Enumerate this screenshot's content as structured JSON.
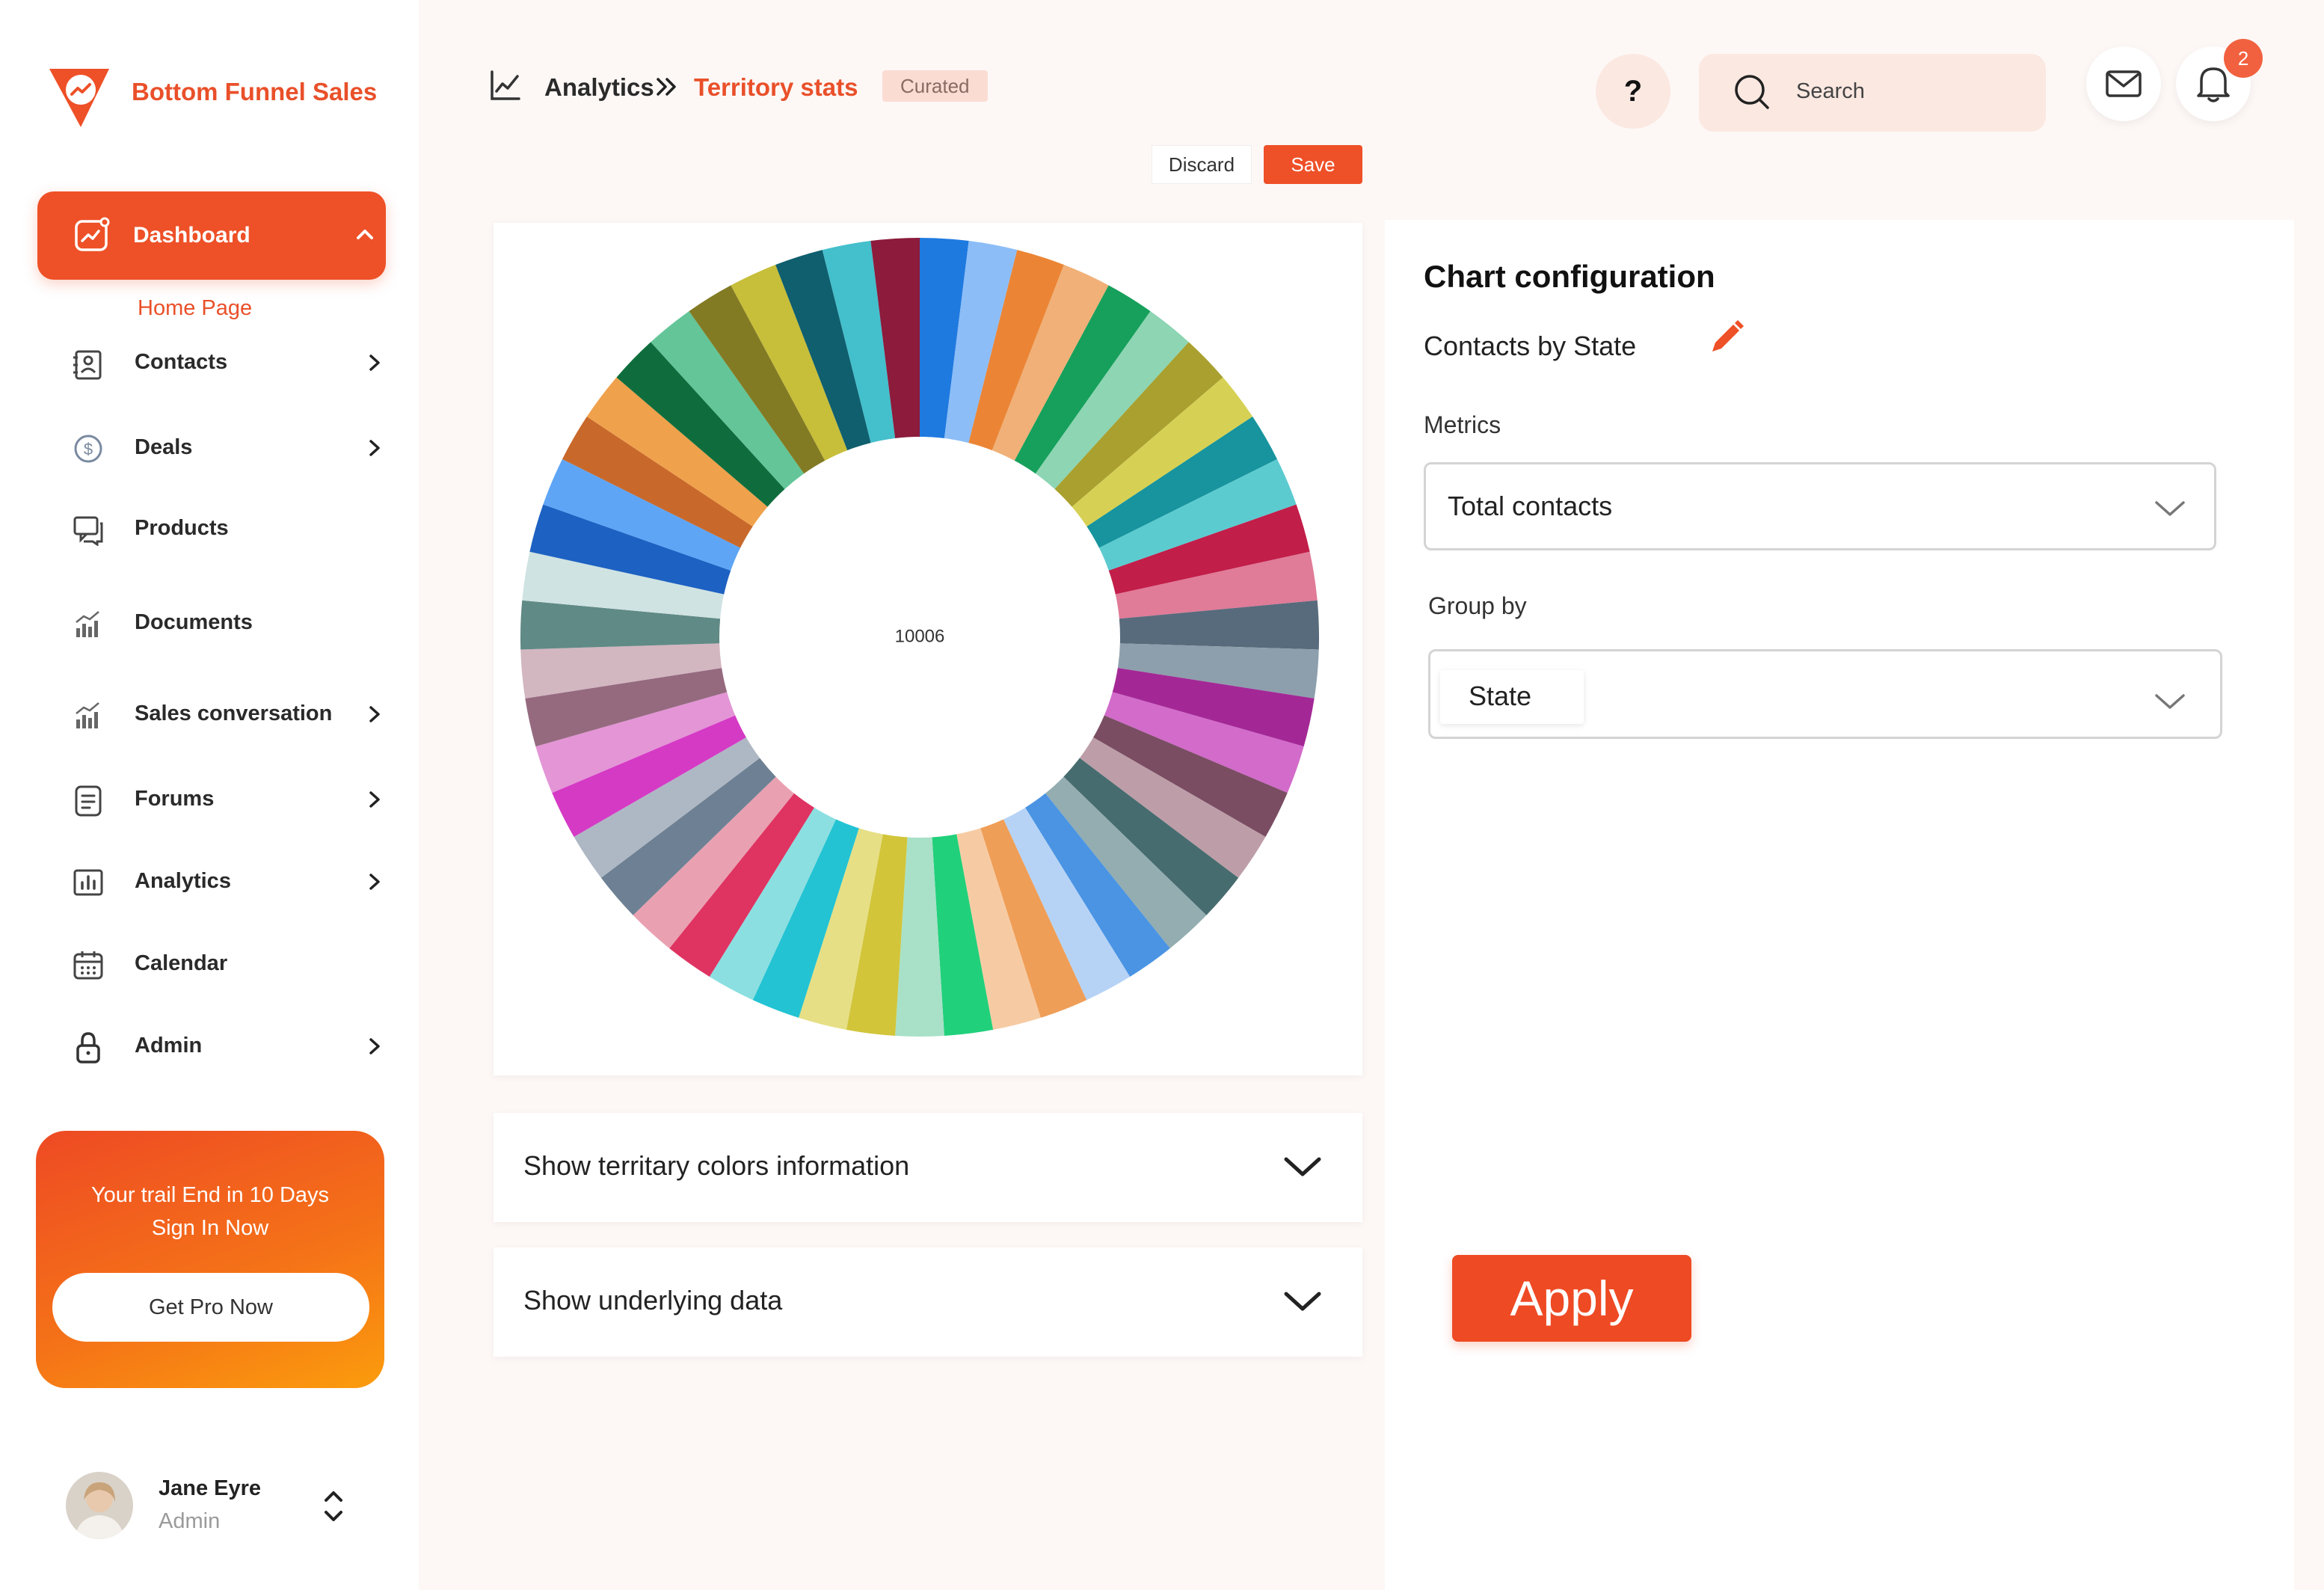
{
  "app": {
    "brand": "Bottom Funnel Sales"
  },
  "sidebar": {
    "active": {
      "label": "Dashboard",
      "subitem": "Home Page"
    },
    "items": [
      {
        "label": "Contacts",
        "icon": "contacts-icon",
        "has_chevron": true
      },
      {
        "label": "Deals",
        "icon": "dollar-icon",
        "has_chevron": true
      },
      {
        "label": "Products",
        "icon": "chat-icon",
        "has_chevron": false
      },
      {
        "label": "Documents",
        "icon": "bar-chart-icon",
        "has_chevron": false
      },
      {
        "label": "Sales conversation",
        "icon": "bar-chart-icon",
        "has_chevron": true
      },
      {
        "label": "Forums",
        "icon": "document-icon",
        "has_chevron": true
      },
      {
        "label": "Analytics",
        "icon": "analytics-icon",
        "has_chevron": true
      },
      {
        "label": "Calendar",
        "icon": "calendar-icon",
        "has_chevron": false
      },
      {
        "label": "Admin",
        "icon": "lock-icon",
        "has_chevron": true
      }
    ],
    "trial": {
      "line1": "Your trail End in 10 Days",
      "line2": "Sign In Now",
      "button": "Get Pro Now"
    },
    "user": {
      "name": "Jane Eyre",
      "role": "Admin"
    }
  },
  "header": {
    "breadcrumb": {
      "section": "Analytics",
      "current": "Territory stats"
    },
    "badge": "Curated",
    "discard_label": "Discard",
    "save_label": "Save",
    "help_label": "?",
    "search_placeholder": "Search",
    "notification_count": "2"
  },
  "chart_data": {
    "type": "pie",
    "center_label": "10006",
    "slice_count": 51,
    "colors": [
      "#1f7ae0",
      "#8cbdf7",
      "#eb8535",
      "#f0b077",
      "#16a05b",
      "#8dd5b3",
      "#a9a02f",
      "#d6d154",
      "#17949d",
      "#5ccbd0",
      "#c21e4a",
      "#e07b98",
      "#586b7c",
      "#8d9fac",
      "#a32896",
      "#d26bca",
      "#7a4d63",
      "#bd9ea8",
      "#476c6f",
      "#93adb1",
      "#4a94e3",
      "#b6d3f6",
      "#ef9e57",
      "#f6cba3",
      "#21d07b",
      "#a8e1c8",
      "#d2c53a",
      "#e6df85",
      "#23c3d3",
      "#8bdfe1",
      "#df3462",
      "#e9a1b1",
      "#6e8194",
      "#aeb8c4",
      "#d53ac5",
      "#e395d6",
      "#956a7f",
      "#d2b6c0",
      "#608a86",
      "#cfe3e2",
      "#1d61c2",
      "#5ea5f6",
      "#c8692b",
      "#f0a14c",
      "#0f6d3d",
      "#63c598",
      "#837b24",
      "#c7be3a",
      "#0f5f6e",
      "#44bfcc",
      "#8c1b3c"
    ],
    "legend": []
  },
  "config": {
    "title": "Chart configuration",
    "chart_name": "Contacts by State",
    "metrics_label": "Metrics",
    "metrics_value": "Total contacts",
    "group_label": "Group by",
    "group_value": "State",
    "apply_label": "Apply"
  },
  "accordions": [
    {
      "label": "Show territary colors information"
    },
    {
      "label": "Show underlying data"
    }
  ],
  "theme": {
    "accent": "#ee5027",
    "accent_soft": "#fbe8e1",
    "sidebar_bg": "#ffffff"
  }
}
